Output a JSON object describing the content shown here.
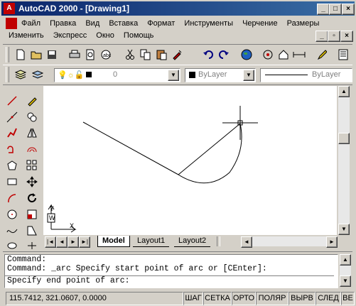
{
  "window": {
    "title": "AutoCAD 2000 - [Drawing1]",
    "app_icon_label": "A"
  },
  "menu_row1": [
    "Файл",
    "Правка",
    "Вид",
    "Вставка",
    "Формат",
    "Инструменты",
    "Черчение",
    "Размеры"
  ],
  "menu_row2": [
    "Изменить",
    "Экспресс",
    "Окно",
    "Помощь"
  ],
  "layers": {
    "layer_value": "0",
    "color_value": "ByLayer",
    "linetype_value": "ByLayer"
  },
  "tabs": [
    "Model",
    "Layout1",
    "Layout2"
  ],
  "command": {
    "line1": "Command:",
    "line2": "Command: _arc Specify start point of arc or [CEnter]:",
    "line3": "Specify end point of arc:"
  },
  "status": {
    "coords": "115.7412, 321.0607, 0.0000",
    "toggles": [
      "ШАГ",
      "СЕТКА",
      "ОРТО",
      "ПОЛЯР",
      "ВЫРВ",
      "СЛЕД",
      "ВЕ"
    ]
  },
  "ucs": {
    "x_label": "X",
    "y_label": "Y",
    "w_label": "W"
  }
}
